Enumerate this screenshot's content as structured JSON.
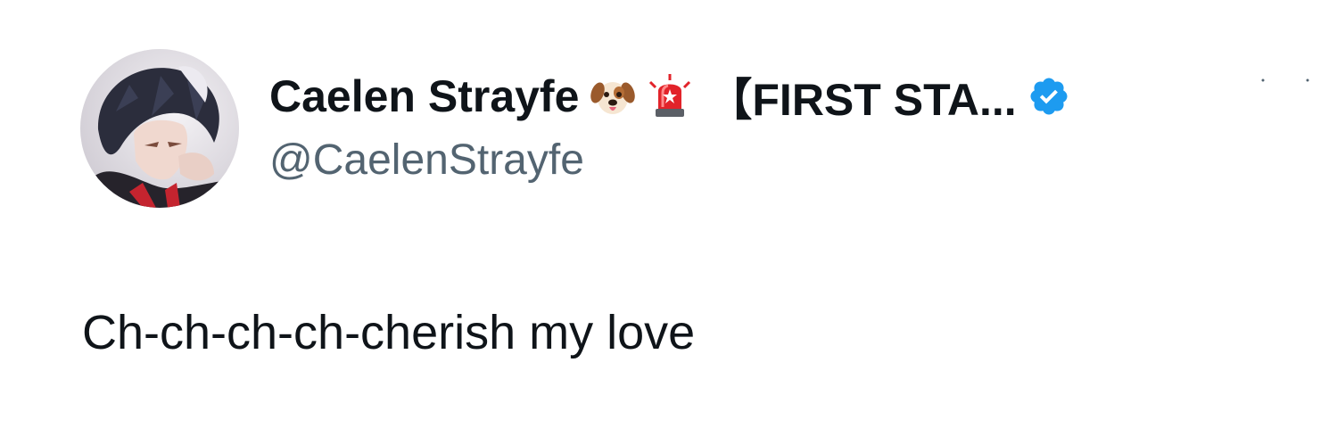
{
  "tweet": {
    "author": {
      "display_name": "Caelen Strayfe",
      "name_emojis": [
        "dog-face-emoji",
        "police-light-emoji"
      ],
      "name_suffix": "【FIRST STA...",
      "verified": true,
      "handle": "@CaelenStrayfe"
    },
    "text": "Ch-ch-ch-ch-cherish my love"
  },
  "colors": {
    "name_text": "#0f1419",
    "handle_text": "#536471",
    "verified_badge": "#1d9bf0",
    "background": "#ffffff"
  }
}
